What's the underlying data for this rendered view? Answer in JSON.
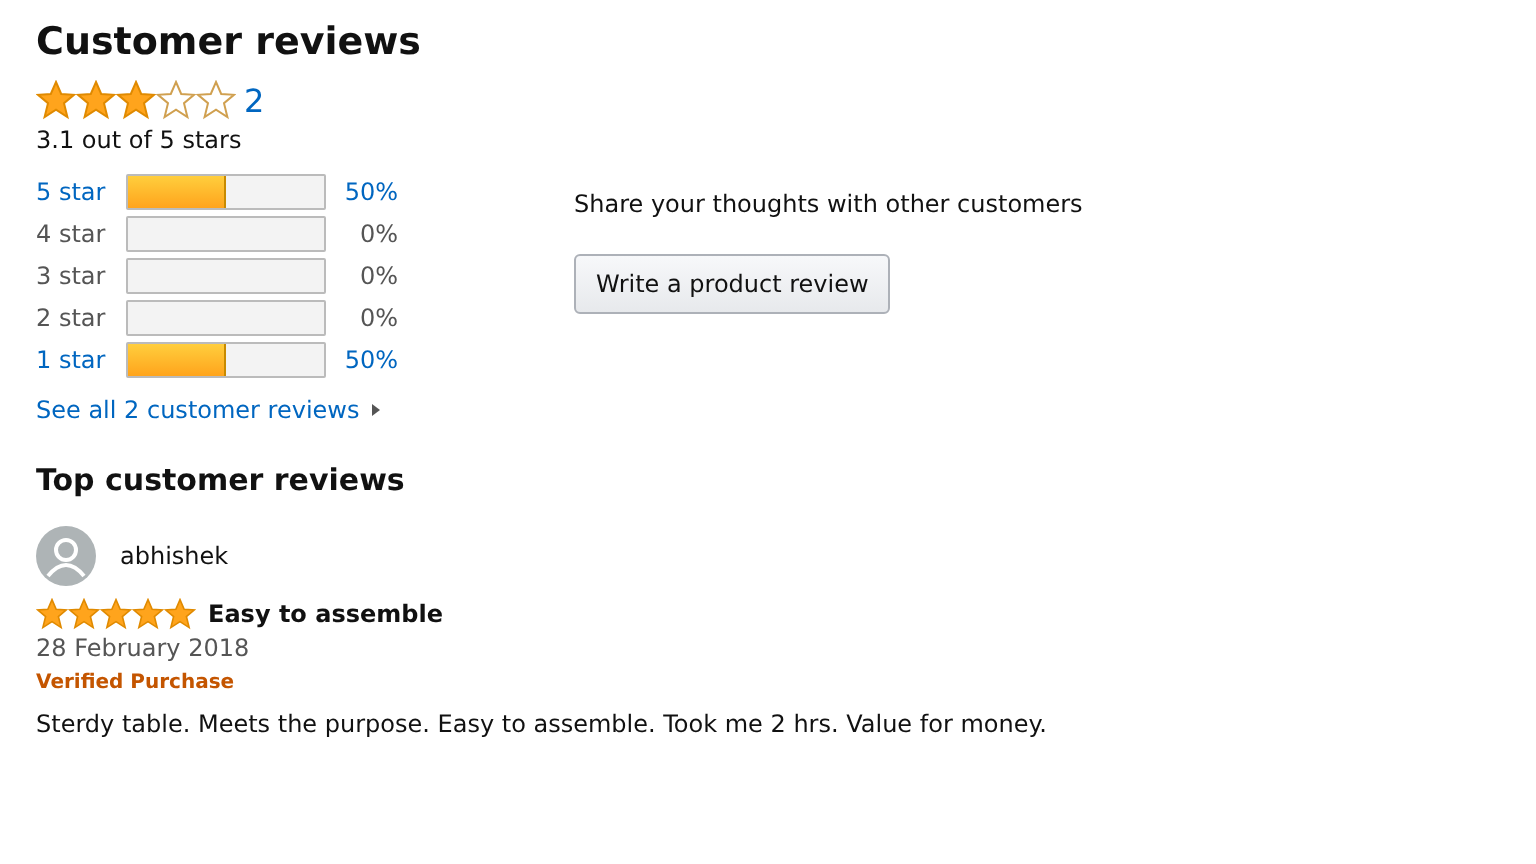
{
  "title": "Customer reviews",
  "summary": {
    "stars": 3,
    "count": "2",
    "average": "3.1 out of 5 stars"
  },
  "histogram": [
    {
      "label": "5 star",
      "level": 0.5,
      "percent": "50%",
      "disabled": false
    },
    {
      "label": "4 star",
      "level": 0,
      "percent": "0%",
      "disabled": true
    },
    {
      "label": "3 star",
      "level": 0,
      "percent": "0%",
      "disabled": true
    },
    {
      "label": "2 star",
      "level": 0,
      "percent": "0%",
      "disabled": true
    },
    {
      "label": "1 star",
      "level": 0.5,
      "percent": "50%",
      "disabled": false
    }
  ],
  "see_all": "See all 2 customer reviews",
  "share": {
    "text": "Share your thoughts with other customers",
    "button": "Write a product review"
  },
  "top_reviews": {
    "heading": "Top customer reviews",
    "reviews": [
      {
        "author": "abhishek",
        "stars": 5,
        "title": "Easy to assemble",
        "date": "28 February 2018",
        "badge": "Verified Purchase",
        "body": "Sterdy table. Meets the purpose. Easy to assemble. Took me 2 hrs. Value for money."
      }
    ]
  }
}
